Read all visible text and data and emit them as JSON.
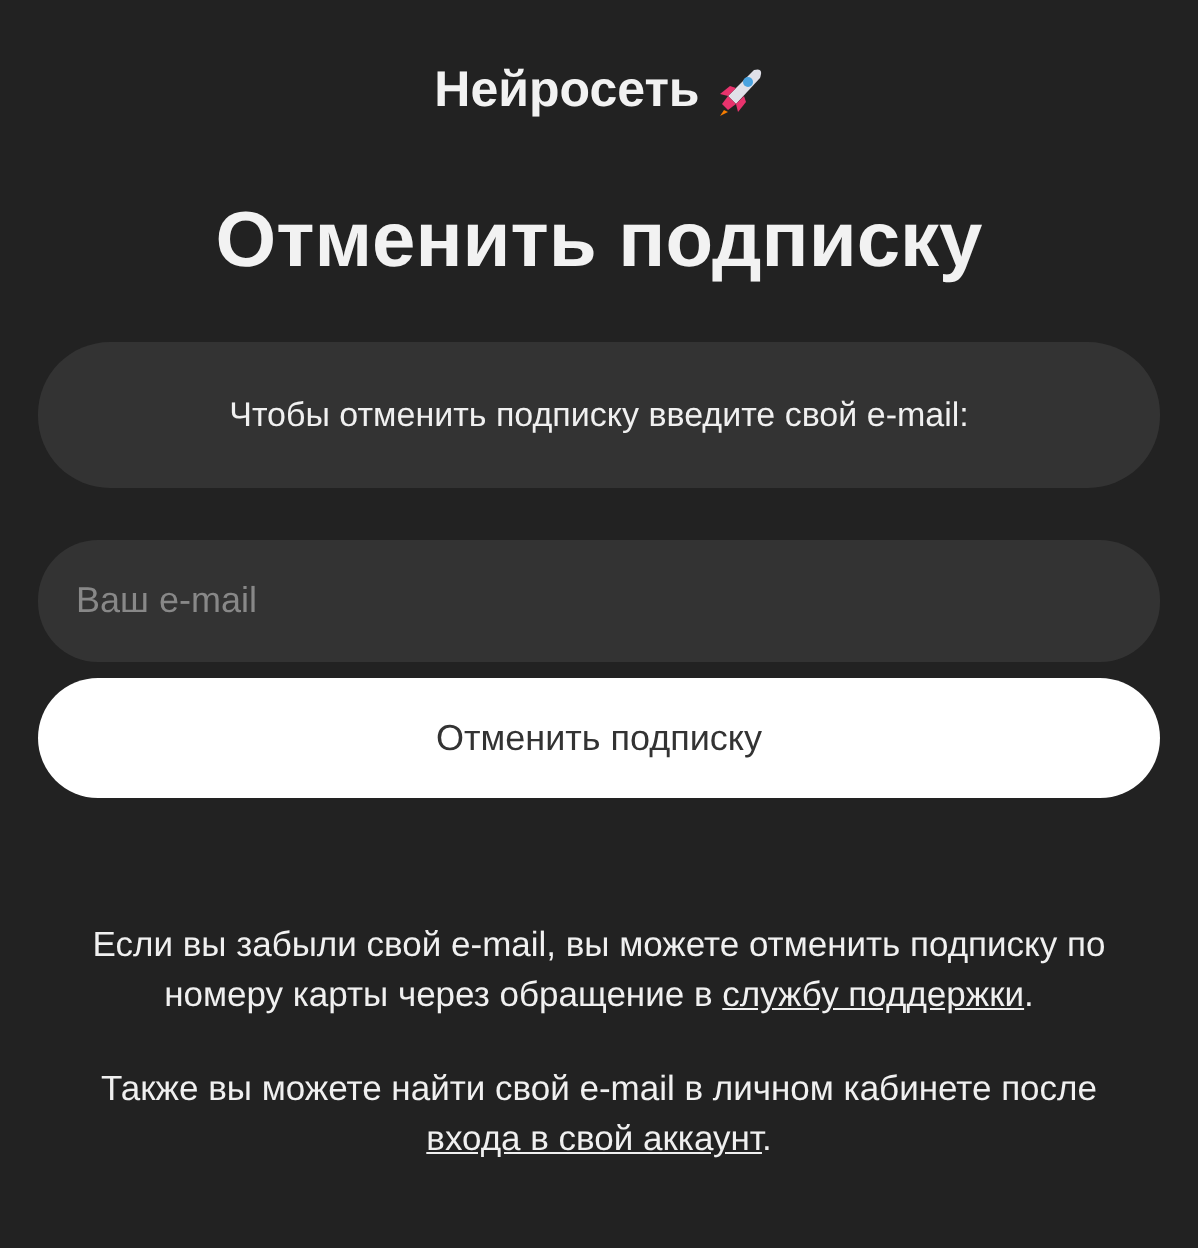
{
  "brand": {
    "name": "Нейросеть"
  },
  "heading": "Отменить подписку",
  "info": "Чтобы отменить подписку введите свой e-mail:",
  "email_field": {
    "placeholder": "Ваш e-mail"
  },
  "submit_button": "Отменить подписку",
  "notes": [
    {
      "before": "Если вы забыли свой e-mail, вы можете отменить подписку по номеру карты через обращение в ",
      "link": "службу поддержки",
      "after": "."
    },
    {
      "before": "Также вы можете найти свой e-mail в личном кабинете после ",
      "link": "входа в свой аккаунт",
      "after": "."
    }
  ]
}
